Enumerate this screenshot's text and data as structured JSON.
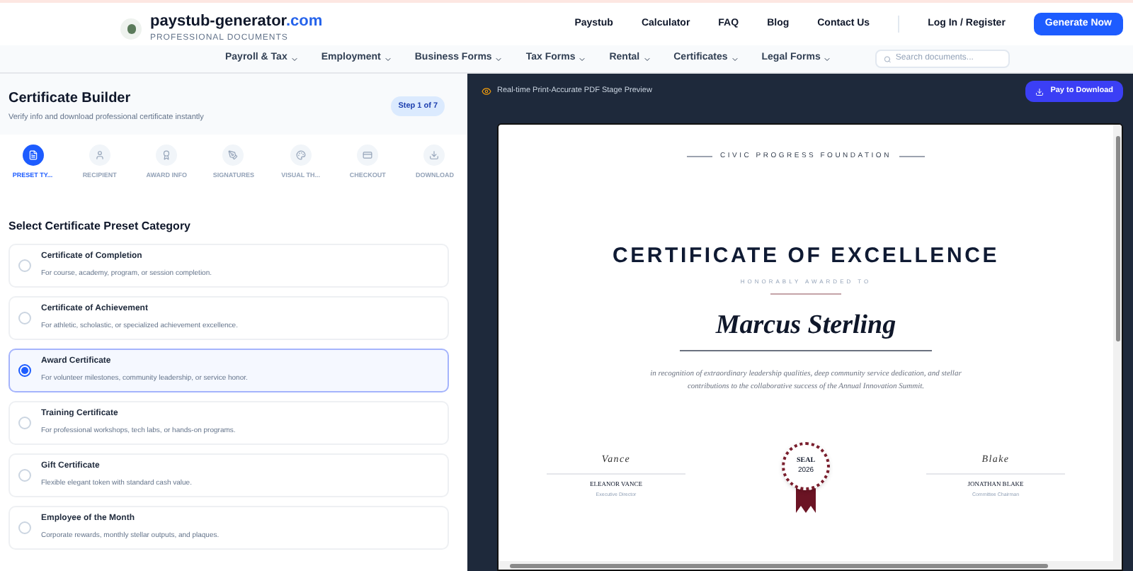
{
  "brand": {
    "name": "paystub-generator",
    "tld": ".com",
    "tagline": "PROFESSIONAL DOCUMENTS"
  },
  "top_links": [
    "Paystub",
    "Calculator",
    "FAQ",
    "Blog",
    "Contact Us"
  ],
  "login": "Log In / Register",
  "cta": "Generate Now",
  "menu": [
    "Payroll & Tax",
    "Employment",
    "Business Forms",
    "Tax Forms",
    "Rental",
    "Certificates",
    "Legal Forms"
  ],
  "search": {
    "placeholder": "Search documents..."
  },
  "builder": {
    "title": "Certificate Builder",
    "subtitle": "Verify info and download professional certificate instantly",
    "step_badge": "Step 1 of 7"
  },
  "steps": [
    {
      "kind": "file",
      "label": "PRESET TY...",
      "selected": true
    },
    {
      "kind": "user",
      "label": "RECIPIENT",
      "selected": false
    },
    {
      "kind": "award",
      "label": "AWARD INFO",
      "selected": false
    },
    {
      "kind": "pen",
      "label": "SIGNATURES",
      "selected": false
    },
    {
      "kind": "palette",
      "label": "VISUAL TH...",
      "selected": false
    },
    {
      "kind": "card",
      "label": "CHECKOUT",
      "selected": false
    },
    {
      "kind": "download",
      "label": "DOWNLOAD",
      "selected": false
    }
  ],
  "section_title": "Select Certificate Preset Category",
  "presets": [
    {
      "title": "Certificate of Completion",
      "desc": "For course, academy, program, or session completion.",
      "selected": false
    },
    {
      "title": "Certificate of Achievement",
      "desc": "For athletic, scholastic, or specialized achievement excellence.",
      "selected": false
    },
    {
      "title": "Award Certificate",
      "desc": "For volunteer milestones, community leadership, or service honor.",
      "selected": true
    },
    {
      "title": "Training Certificate",
      "desc": "For professional workshops, tech labs, or hands-on programs.",
      "selected": false
    },
    {
      "title": "Gift Certificate",
      "desc": "Flexible elegant token with standard cash value.",
      "selected": false
    },
    {
      "title": "Employee of the Month",
      "desc": "Corporate rewards, monthly stellar outputs, and plaques.",
      "selected": false
    }
  ],
  "preview": {
    "label": "Real-time Print-Accurate PDF Stage Preview",
    "button": "Pay to Download"
  },
  "certificate": {
    "organization": "CIVIC PROGRESS FOUNDATION",
    "title": "CERTIFICATE OF EXCELLENCE",
    "awarded": "HONORABLY AWARDED TO",
    "recipient": "Marcus Sterling",
    "body": "in recognition of extraordinary leadership qualities, deep community service dedication, and stellar contributions to the collaborative success of the Annual Innovation Summit.",
    "signatures": [
      {
        "script": "Vance",
        "name": "ELEANOR VANCE",
        "role": "Executive Director"
      },
      {
        "script": "Blake",
        "name": "JONATHAN BLAKE",
        "role": "Committee Chairman"
      }
    ],
    "seal": {
      "label": "SEAL",
      "year": "2026"
    }
  }
}
